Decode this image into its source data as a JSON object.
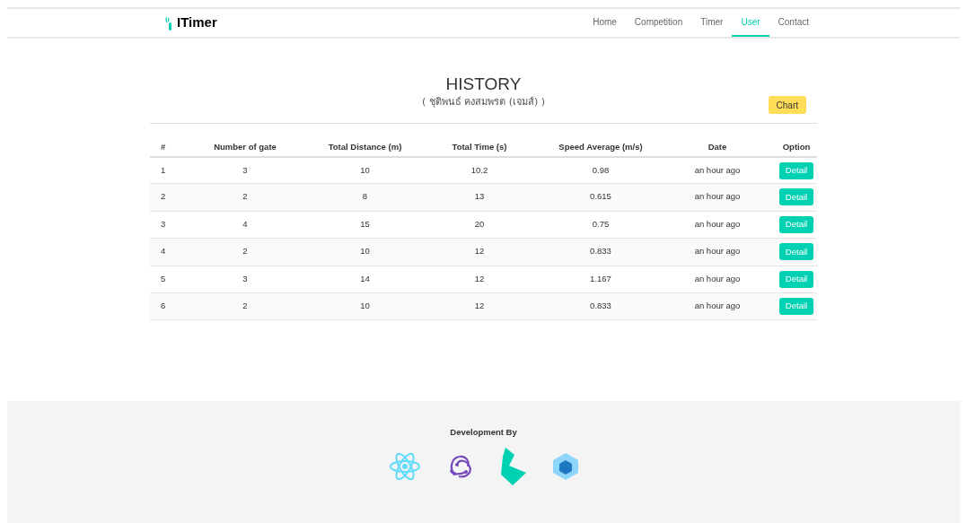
{
  "brand": "ITimer",
  "nav": [
    {
      "label": "Home",
      "selected": false
    },
    {
      "label": "Competition",
      "selected": false
    },
    {
      "label": "Timer",
      "selected": false
    },
    {
      "label": "User",
      "selected": true
    },
    {
      "label": "Contact",
      "selected": false
    }
  ],
  "title": "HISTORY",
  "subtitle": "( ชุติพนธ์ คงสมพรต (เจมส์) )",
  "chart_button": "Chart",
  "table": {
    "columns": [
      "#",
      "Number of gate",
      "Total Distance (m)",
      "Total Time (s)",
      "Speed Average (m/s)",
      "Date",
      "Option"
    ],
    "rows": [
      {
        "cells": [
          "1",
          "3",
          "10",
          "10.2",
          "0.98",
          "an hour ago"
        ],
        "action": "Detail"
      },
      {
        "cells": [
          "2",
          "2",
          "8",
          "13",
          "0.615",
          "an hour ago"
        ],
        "action": "Detail"
      },
      {
        "cells": [
          "3",
          "4",
          "15",
          "20",
          "0.75",
          "an hour ago"
        ],
        "action": "Detail"
      },
      {
        "cells": [
          "4",
          "2",
          "10",
          "12",
          "0.833",
          "an hour ago"
        ],
        "action": "Detail"
      },
      {
        "cells": [
          "5",
          "3",
          "14",
          "12",
          "1.167",
          "an hour ago"
        ],
        "action": "Detail"
      },
      {
        "cells": [
          "6",
          "2",
          "10",
          "12",
          "0.833",
          "an hour ago"
        ],
        "action": "Detail"
      }
    ]
  },
  "footer": {
    "heading": "Development By"
  }
}
